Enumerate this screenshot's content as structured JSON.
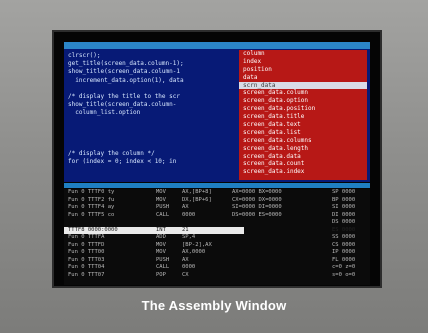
{
  "caption": "The Assembly Window",
  "colors": {
    "source_pane": "#071a76",
    "symbol_list": "#b71816",
    "title_bar": "#2b86c8",
    "assembly_pane": "#0b0b0b",
    "highlight": "#eaeaea"
  },
  "source": {
    "lines": [
      {
        "no": "",
        "text": "clrscr();"
      },
      {
        "no": "",
        "text": "get_title(screen_data.column-1);"
      },
      {
        "no": "",
        "text": "show_title(screen_data.column-1"
      },
      {
        "no": "",
        "text": "  increment_data.option(1), data"
      },
      {
        "no": "",
        "text": ""
      },
      {
        "no": "",
        "text": "/* display the title to the scr"
      },
      {
        "no": "",
        "text": "show_title(screen_data.column-"
      },
      {
        "no": "",
        "text": "  column_list.option"
      },
      {
        "no": "",
        "text": ""
      },
      {
        "no": "",
        "text": ""
      },
      {
        "no": "",
        "text": ""
      },
      {
        "no": "",
        "text": ""
      },
      {
        "no": "",
        "text": "/* display the column */"
      },
      {
        "no": "",
        "text": "for (index = 0; index < 10; in"
      }
    ]
  },
  "symbols": {
    "items": [
      {
        "label": "column"
      },
      {
        "label": "index"
      },
      {
        "label": "position"
      },
      {
        "label": "data"
      },
      {
        "label": "scrn_data"
      },
      {
        "label": "screen_data.column"
      },
      {
        "label": "screen_data.option"
      },
      {
        "label": "screen_data.position"
      },
      {
        "label": "screen_data.title"
      },
      {
        "label": "screen_data.text"
      },
      {
        "label": "screen_data.list"
      },
      {
        "label": "screen_data.columns"
      },
      {
        "label": "screen_data.length"
      },
      {
        "label": "screen_data.data"
      },
      {
        "label": "screen_data.count"
      },
      {
        "label": "screen_data.index"
      }
    ],
    "selected_index": 4
  },
  "assembly": {
    "rows": [
      {
        "addr": "Fun  0 TTTF0 ty",
        "op": "MOV",
        "args": "AX,[BP+8]",
        "extra": "AX=0000 BX=0000",
        "reg": "SP 0000"
      },
      {
        "addr": "Fun  0 TTTF2 fu",
        "op": "MOV",
        "args": "DX,[BP+6]",
        "extra": "CX=0000 DX=0000",
        "reg": "BP 0000"
      },
      {
        "addr": "Fun  0 TTTF4 ay",
        "op": "PUSH",
        "args": "AX",
        "extra": "SI=0000 DI=0000",
        "reg": "SI 0000"
      },
      {
        "addr": "Fun  0 TTTF5 co",
        "op": "CALL",
        "args": "0000",
        "extra": "DS=0000 ES=0000",
        "reg": "DI 0000"
      },
      {
        "addr": "",
        "op": "",
        "args": "",
        "extra": "",
        "reg": "DS 0000"
      },
      {
        "addr": "TTTF8 0000:0000",
        "op": "INT",
        "args": "21",
        "extra": "",
        "reg": "ES 0000"
      },
      {
        "addr": "Fun  0 TTTFA",
        "op": "ADD",
        "args": "SP,4",
        "extra": "",
        "reg": "SS 0000"
      },
      {
        "addr": "Fun  0 TTTFD",
        "op": "MOV",
        "args": "[BP-2],AX",
        "extra": "",
        "reg": "CS 0000"
      },
      {
        "addr": "Fun  0 TTT00",
        "op": "MOV",
        "args": "AX,0000",
        "extra": "",
        "reg": "IP 0000"
      },
      {
        "addr": "Fun  0 TTT03",
        "op": "PUSH",
        "args": "AX",
        "extra": "",
        "reg": "FL 0000"
      },
      {
        "addr": "Fun  0 TTT04",
        "op": "CALL",
        "args": "0000",
        "extra": "",
        "reg": "c=0 z=0"
      },
      {
        "addr": "Fun  0 TTT07",
        "op": "POP",
        "args": "CX",
        "extra": "",
        "reg": "s=0 o=0"
      }
    ],
    "highlight_index": 5
  }
}
